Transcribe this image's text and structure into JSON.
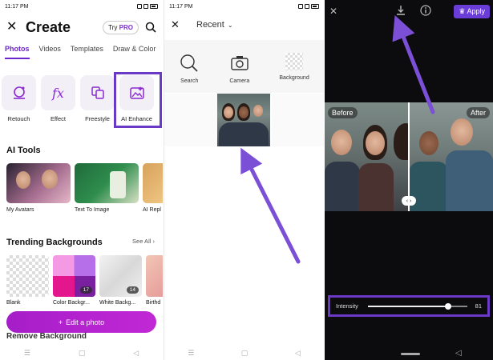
{
  "status_time": "11:17 PM",
  "create_screen": {
    "title": "Create",
    "try_pro_prefix": "Try",
    "try_pro_highlight": "PRO",
    "tabs": [
      {
        "label": "Photos",
        "active": true
      },
      {
        "label": "Videos",
        "active": false
      },
      {
        "label": "Templates",
        "active": false
      },
      {
        "label": "Draw & Color",
        "active": false
      }
    ],
    "tools": [
      {
        "label": "Retouch",
        "icon": "retouch-icon"
      },
      {
        "label": "Effect",
        "icon": "fx-icon"
      },
      {
        "label": "Freestyle",
        "icon": "freestyle-icon"
      },
      {
        "label": "AI Enhance",
        "icon": "ai-enhance-icon"
      }
    ],
    "ai_tools_title": "AI Tools",
    "ai_tools": [
      {
        "label": "My Avatars"
      },
      {
        "label": "Text To Image"
      },
      {
        "label": "AI Repl"
      }
    ],
    "trending_title": "Trending Backgrounds",
    "see_all_label": "See All",
    "backgrounds": [
      {
        "label": "Blank",
        "count": ""
      },
      {
        "label": "Color Backgr...",
        "count": "17"
      },
      {
        "label": "White Backg...",
        "count": "14"
      },
      {
        "label": "Birthd",
        "count": ""
      }
    ],
    "edit_photo_label": "Edit a photo",
    "remove_background_label": "Remove Background"
  },
  "picker_screen": {
    "dropdown_label": "Recent",
    "sources": [
      {
        "label": "Search",
        "icon": "search-icon"
      },
      {
        "label": "Camera",
        "icon": "camera-icon"
      },
      {
        "label": "Background",
        "icon": "transparent-grid-icon"
      }
    ]
  },
  "enhance_screen": {
    "apply_label": "Apply",
    "before_label": "Before",
    "after_label": "After",
    "intensity_label": "Intensity",
    "intensity_value": "81",
    "intensity_fraction": 0.81
  },
  "colors": {
    "accent": "#6c26c9",
    "highlight_frame": "#6a3ac6",
    "arrow": "#7b4fd6",
    "edit_button": "#b423cf"
  }
}
